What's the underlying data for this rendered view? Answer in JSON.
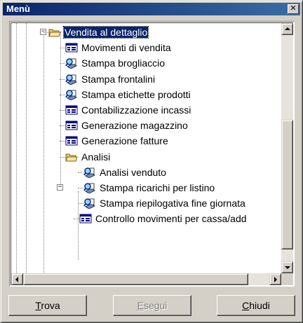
{
  "window": {
    "title": "Menù"
  },
  "tree": {
    "items": [
      {
        "label": "Vendita al dettaglio",
        "type": "folder-open",
        "selected": true,
        "icon": "open-folder-icon"
      },
      {
        "label": "Movimenti di vendita",
        "type": "form",
        "icon": "form-icon"
      },
      {
        "label": "Stampa brogliaccio",
        "type": "report",
        "icon": "report-magnifier-icon"
      },
      {
        "label": "Stampa frontalini",
        "type": "report",
        "icon": "report-magnifier-icon"
      },
      {
        "label": "Stampa etichette prodotti",
        "type": "report",
        "icon": "report-magnifier-icon"
      },
      {
        "label": "Contabilizzazione incassi",
        "type": "form",
        "icon": "form-icon"
      },
      {
        "label": "Generazione magazzino",
        "type": "form",
        "icon": "form-icon"
      },
      {
        "label": "Generazione fatture",
        "type": "form",
        "icon": "form-icon"
      },
      {
        "label": "Analisi",
        "type": "folder-open",
        "icon": "open-folder-icon"
      },
      {
        "label": "Analisi venduto",
        "type": "report",
        "icon": "report-magnifier-icon"
      },
      {
        "label": "Stampa ricarichi per listino",
        "type": "report",
        "icon": "report-magnifier-icon"
      },
      {
        "label": "Stampa riepilogativa fine giornata",
        "type": "report",
        "icon": "report-magnifier-icon"
      },
      {
        "label": "Controllo movimenti per cassa/add",
        "type": "form",
        "icon": "form-icon"
      }
    ]
  },
  "buttons": {
    "find": {
      "pre": "",
      "key": "T",
      "post": "rova"
    },
    "run": {
      "pre": "",
      "key": "E",
      "post": "segui",
      "disabled": true
    },
    "close": {
      "pre": "",
      "key": "C",
      "post": "hiudi"
    }
  },
  "colors": {
    "titlebar": "#0a246a",
    "selection": "#0a246a",
    "face": "#d4d0c8"
  }
}
